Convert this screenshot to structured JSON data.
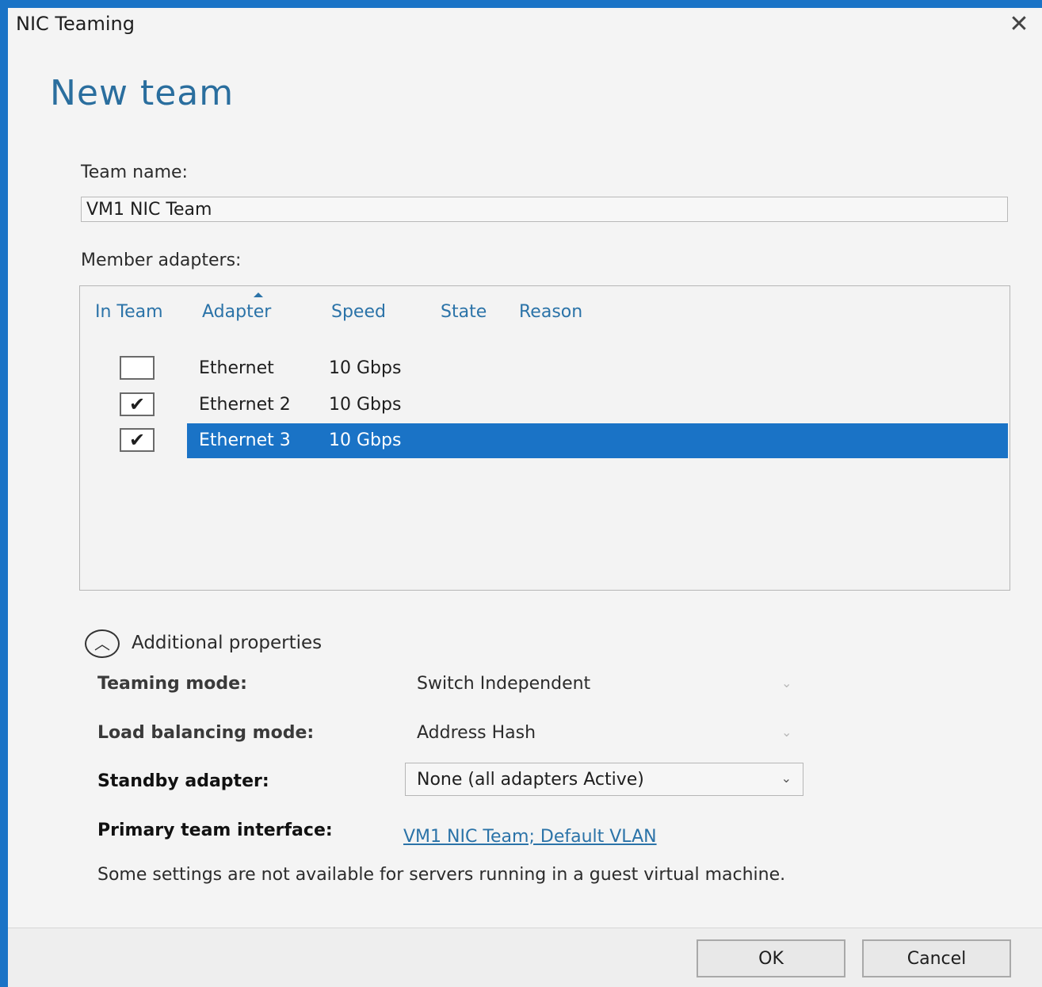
{
  "window": {
    "title": "NIC Teaming",
    "close_icon": "close-icon"
  },
  "heading": "New team",
  "team_name": {
    "label": "Team name:",
    "value": "VM1 NIC Team"
  },
  "member_adapters": {
    "label": "Member adapters:",
    "columns": [
      "In Team",
      "Adapter",
      "Speed",
      "State",
      "Reason"
    ],
    "rows": [
      {
        "in_team": false,
        "checkmark": "",
        "adapter": "Ethernet",
        "speed": "10 Gbps",
        "state": "",
        "reason": "",
        "selected": false
      },
      {
        "in_team": true,
        "checkmark": "✔",
        "adapter": "Ethernet 2",
        "speed": "10 Gbps",
        "state": "",
        "reason": "",
        "selected": false
      },
      {
        "in_team": true,
        "checkmark": "✔",
        "adapter": "Ethernet 3",
        "speed": "10 Gbps",
        "state": "",
        "reason": "",
        "selected": true
      }
    ]
  },
  "additional_properties": {
    "label": "Additional properties",
    "expanded": true,
    "teaming_mode": {
      "label": "Teaming mode:",
      "value": "Switch Independent"
    },
    "load_balancing_mode": {
      "label": "Load balancing mode:",
      "value": "Address Hash"
    },
    "standby_adapter": {
      "label": "Standby adapter:",
      "value": "None (all adapters Active)"
    },
    "primary_team_interface": {
      "label": "Primary team interface:",
      "link": "VM1 NIC Team; Default VLAN"
    },
    "note": "Some settings are not available for servers running in a guest virtual machine."
  },
  "buttons": {
    "ok": "OK",
    "cancel": "Cancel"
  },
  "colors": {
    "accent": "#1a73c6",
    "link": "#2b73a8",
    "heading": "#2a6e9e"
  }
}
